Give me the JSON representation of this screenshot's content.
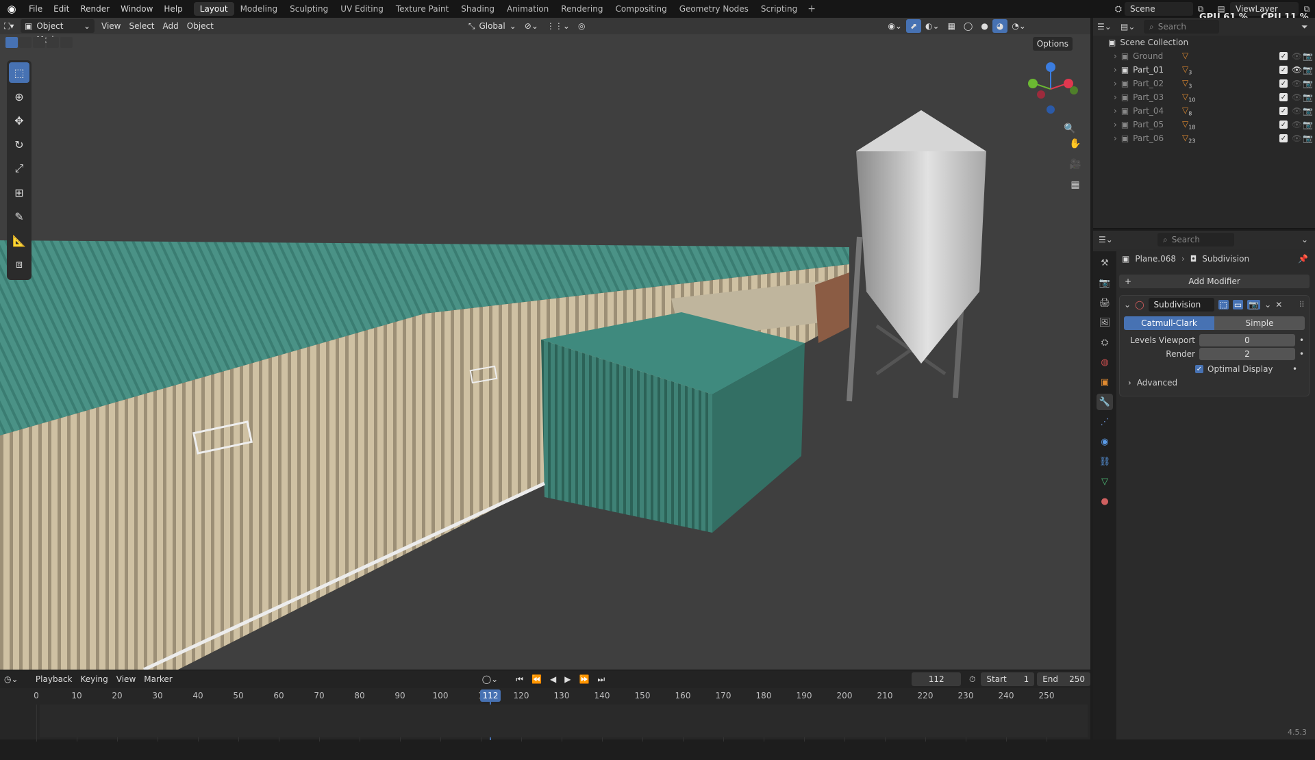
{
  "menu": [
    "File",
    "Edit",
    "Render",
    "Window",
    "Help"
  ],
  "workspaces": [
    "Layout",
    "Modeling",
    "Sculpting",
    "UV Editing",
    "Texture Paint",
    "Shading",
    "Animation",
    "Rendering",
    "Compositing",
    "Geometry Nodes",
    "Scripting"
  ],
  "active_workspace": "Layout",
  "scene_name": "Scene",
  "view_layer": "ViewLayer",
  "stats": {
    "gpu": "GPU 61 %",
    "cpu": "CPU 11 %"
  },
  "viewport_header": {
    "mode": "Object Mode",
    "menus": [
      "View",
      "Select",
      "Add",
      "Object"
    ],
    "orientation": "Global",
    "options": "Options"
  },
  "outliner": {
    "search_placeholder": "Search",
    "collection": "Scene Collection",
    "items": [
      {
        "name": "Ground",
        "count": ""
      },
      {
        "name": "Part_01",
        "count": "3"
      },
      {
        "name": "Part_02",
        "count": "3"
      },
      {
        "name": "Part_03",
        "count": "10"
      },
      {
        "name": "Part_04",
        "count": "8"
      },
      {
        "name": "Part_05",
        "count": "18"
      },
      {
        "name": "Part_06",
        "count": "23"
      }
    ]
  },
  "properties": {
    "search_placeholder": "Search",
    "object": "Plane.068",
    "modifier_context": "Subdivision",
    "add_modifier": "Add Modifier",
    "modifier_name": "Subdivision",
    "type_a": "Catmull-Clark",
    "type_b": "Simple",
    "levels_viewport_label": "Levels Viewport",
    "levels_viewport": "0",
    "render_label": "Render",
    "render": "2",
    "optimal_display": "Optimal Display",
    "advanced": "Advanced"
  },
  "timeline": {
    "menus": [
      "Playback",
      "Keying",
      "View",
      "Marker"
    ],
    "current_frame": "112",
    "start_label": "Start",
    "start": "1",
    "end_label": "End",
    "end": "250",
    "ticks": [
      "0",
      "10",
      "20",
      "30",
      "40",
      "50",
      "60",
      "70",
      "80",
      "90",
      "100",
      "1",
      "120",
      "130",
      "140",
      "150",
      "160",
      "170",
      "180",
      "190",
      "200",
      "210",
      "220",
      "230",
      "240",
      "250"
    ]
  },
  "version": "4.5.3",
  "colors": {
    "accent": "#4772b3",
    "roof": "#3e8a80",
    "wall": "#d4c6a7",
    "silo": "#c9c9c9"
  }
}
